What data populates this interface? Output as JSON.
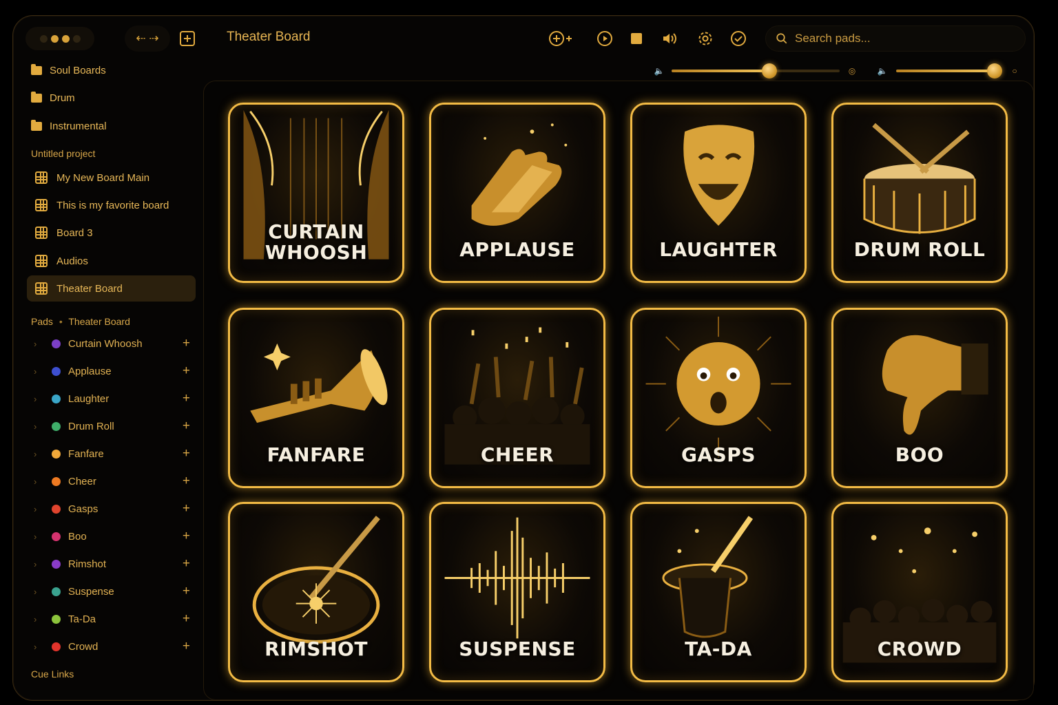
{
  "window": {
    "title": "Theater Board"
  },
  "toolbar": {
    "nav_label": "⇠ ⇢",
    "search_placeholder": "Search pads..."
  },
  "sidebar": {
    "folders": [
      {
        "label": "Soul Boards"
      },
      {
        "label": "Drum"
      },
      {
        "label": "Instrumental"
      }
    ],
    "project_label": "Untitled project",
    "boards": [
      {
        "label": "My New Board Main"
      },
      {
        "label": "This is my favorite board"
      },
      {
        "label": "Board 3"
      },
      {
        "label": "Audios"
      },
      {
        "label": "Theater Board",
        "active": true
      }
    ],
    "pads_section": {
      "prefix": "Pads",
      "board": "Theater Board"
    },
    "pads": [
      {
        "label": "Curtain Whoosh",
        "color": "#7b3fc7"
      },
      {
        "label": "Applause",
        "color": "#3d4fd0"
      },
      {
        "label": "Laughter",
        "color": "#3aa6c8"
      },
      {
        "label": "Drum Roll",
        "color": "#3fae6a"
      },
      {
        "label": "Fanfare",
        "color": "#f0a83a"
      },
      {
        "label": "Cheer",
        "color": "#ee7a22"
      },
      {
        "label": "Gasps",
        "color": "#e0442e"
      },
      {
        "label": "Boo",
        "color": "#d4336f"
      },
      {
        "label": "Rimshot",
        "color": "#8a3cc9"
      },
      {
        "label": "Suspense",
        "color": "#3aa38f"
      },
      {
        "label": "Ta-Da",
        "color": "#8cc43c"
      },
      {
        "label": "Crowd",
        "color": "#e2342c"
      }
    ],
    "cue_links_label": "Cue Links"
  },
  "volume": {
    "slider1_level": 0.58,
    "slider2_level": 0.98
  },
  "grid": {
    "pads": [
      {
        "label_lines": [
          "CURTAIN",
          "WHOOSH"
        ],
        "art": "curtain-art"
      },
      {
        "label_lines": [
          "APPLAUSE"
        ],
        "art": "clapping-hands-art"
      },
      {
        "label_lines": [
          "LAUGHTER"
        ],
        "art": "comedy-mask-art"
      },
      {
        "label_lines": [
          "DRUM ROLL"
        ],
        "art": "snare-drum-art"
      },
      {
        "label_lines": [
          "FANFARE"
        ],
        "art": "trumpet-art"
      },
      {
        "label_lines": [
          "CHEER"
        ],
        "art": "cheering-crowd-art"
      },
      {
        "label_lines": [
          "GASPS"
        ],
        "art": "gasp-face-art"
      },
      {
        "label_lines": [
          "BOO"
        ],
        "art": "thumbs-down-art"
      },
      {
        "label_lines": [
          "RIMSHOT"
        ],
        "art": "rimshot-drum-art"
      },
      {
        "label_lines": [
          "SUSPENSE"
        ],
        "art": "waveform-art"
      },
      {
        "label_lines": [
          "TA-DA"
        ],
        "art": "magic-hat-art"
      },
      {
        "label_lines": [
          "CROWD"
        ],
        "art": "crowd-lights-art"
      }
    ]
  },
  "colors": {
    "accent": "#f3bb45",
    "background": "#060504"
  }
}
